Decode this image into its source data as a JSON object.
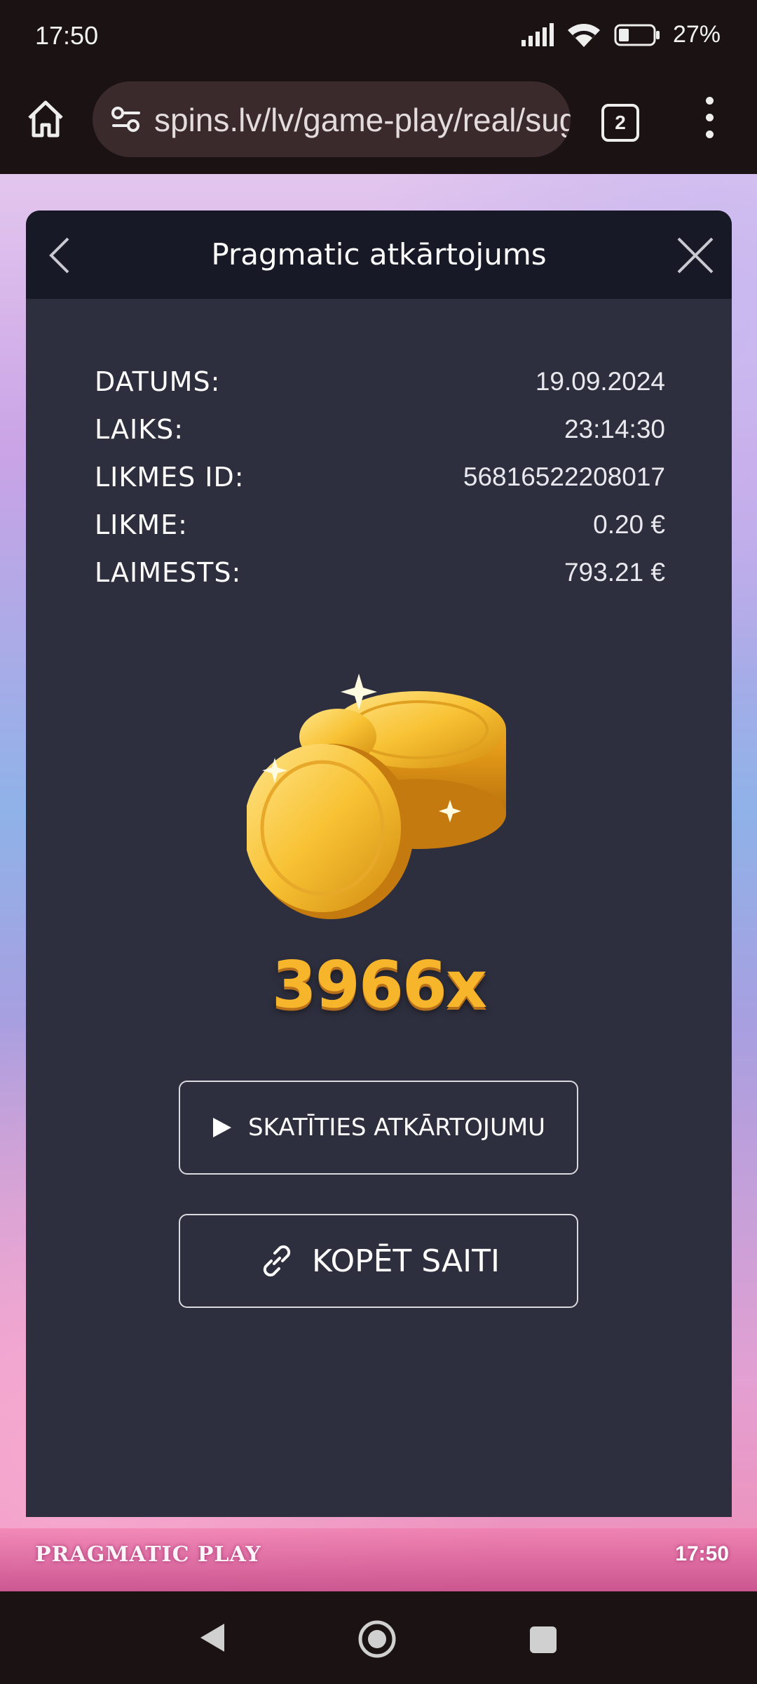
{
  "status_bar": {
    "time": "17:50",
    "battery_percent": "27%",
    "icons": [
      "signal-icon",
      "wifi-icon",
      "battery-icon"
    ]
  },
  "browser": {
    "url": "spins.lv/lv/game-play/real/sug",
    "tab_count": "2",
    "icons": [
      "home-icon",
      "site-settings-icon",
      "tabs-icon",
      "overflow-menu-icon"
    ]
  },
  "game": {
    "provider": "PRAGMATIC PLAY",
    "clock": "17:50"
  },
  "modal": {
    "title": "Pragmatic atkārtojums",
    "rows": [
      {
        "label": "DATUMS:",
        "value": "19.09.2024"
      },
      {
        "label": "LAIKS:",
        "value": "23:14:30"
      },
      {
        "label": "LIKMES ID:",
        "value": "56816522208017"
      },
      {
        "label": "LIKME:",
        "value": "0.20 €"
      },
      {
        "label": "LAIMESTS:",
        "value": "793.21 €"
      }
    ],
    "multiplier": "3966x",
    "replay_button": "SKATĪTIES ATKĀRTOJUMU",
    "copy_button": "KOPĒT SAITI",
    "colors": {
      "panel": "#2e2f3e",
      "header": "#171a26",
      "gold": "#f6b52a"
    }
  },
  "nav": {
    "icons": [
      "nav-back-icon",
      "nav-home-icon",
      "nav-recents-icon"
    ]
  }
}
